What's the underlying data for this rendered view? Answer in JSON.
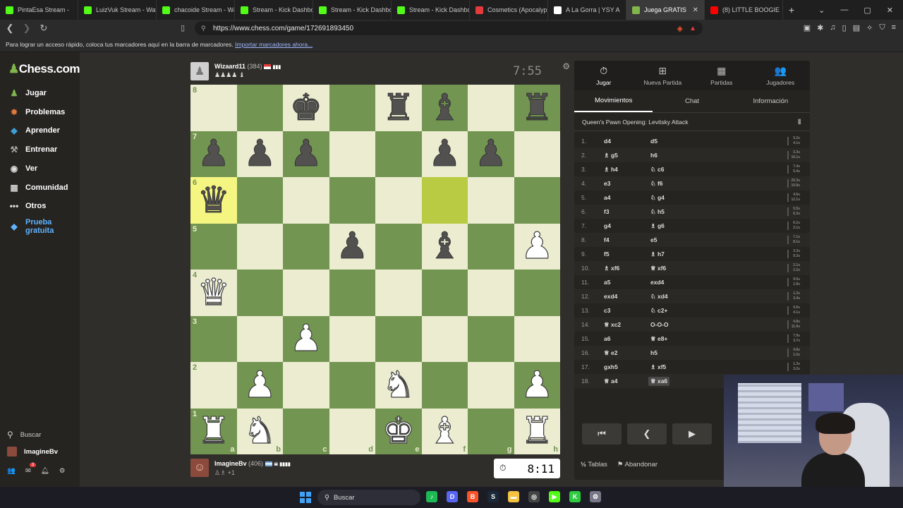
{
  "browser": {
    "tabs": [
      {
        "label": "PintaEsa Stream - ",
        "icon": "kick-icon",
        "color": "#53fc18",
        "active": false
      },
      {
        "label": "LuizVuk Stream - Wat",
        "icon": "kick-icon",
        "color": "#53fc18",
        "active": false
      },
      {
        "label": "chacoide Stream - Wa",
        "icon": "kick-icon",
        "color": "#53fc18",
        "active": false
      },
      {
        "label": "Stream - Kick Dashbo",
        "icon": "kick-icon",
        "color": "#53fc18",
        "active": false
      },
      {
        "label": "Stream - Kick Dashbo",
        "icon": "kick-icon",
        "color": "#53fc18",
        "active": false
      },
      {
        "label": "Stream - Kick Dashbo",
        "icon": "kick-icon",
        "color": "#53fc18",
        "active": false
      },
      {
        "label": "Cosmetics (Apocalyp",
        "icon": "a-icon",
        "color": "#e33b3b",
        "active": false
      },
      {
        "label": "A La Gorra | YSY A",
        "icon": "tiktok-icon",
        "color": "#ffffff",
        "active": false
      },
      {
        "label": "Juega GRATIS",
        "icon": "chess-icon",
        "color": "#81b64c",
        "active": true
      },
      {
        "label": "(8) LITTLE BOOGIE",
        "icon": "youtube-icon",
        "color": "#ff0000",
        "active": false
      }
    ],
    "url": "https://www.chess.com/game/172691893450",
    "bookmarks_text": "Para lograr un acceso rápido, coloca tus marcadores aquí en la barra de marcadores.",
    "bookmarks_link": "Importar marcadores ahora..."
  },
  "sidebar": {
    "logo": "Chess.com",
    "items": [
      {
        "label": "Jugar",
        "icon": "play-icon",
        "glyph": "♟",
        "color": "#81b64c"
      },
      {
        "label": "Problemas",
        "icon": "puzzle-icon",
        "glyph": "✸",
        "color": "#e27a3f"
      },
      {
        "label": "Aprender",
        "icon": "learn-icon",
        "glyph": "◆",
        "color": "#3aa0d8"
      },
      {
        "label": "Entrenar",
        "icon": "train-icon",
        "glyph": "⚒",
        "color": "#aaaaaa"
      },
      {
        "label": "Ver",
        "icon": "watch-icon",
        "glyph": "◉",
        "color": "#dddddd"
      },
      {
        "label": "Comunidad",
        "icon": "community-icon",
        "glyph": "▦",
        "color": "#cccccc"
      },
      {
        "label": "Otros",
        "icon": "more-icon",
        "glyph": "•••",
        "color": "#dddddd"
      }
    ],
    "trial_label_1": "Prueba",
    "trial_label_2": "gratuita",
    "search_label": "Buscar",
    "username": "ImagineBv",
    "notification_count": "3"
  },
  "game": {
    "opponent": {
      "name": "Wizaard11",
      "rating": "(384)",
      "captured": "♟♟♟♟ ♝",
      "clock": "7:55"
    },
    "me": {
      "name": "ImagineBv",
      "rating": "(406)",
      "captured": "♙♗ +1",
      "clock": "8:11"
    },
    "board": [
      [
        "",
        "",
        "bk",
        "",
        "br",
        "bb",
        "",
        "br"
      ],
      [
        "bp",
        "bp",
        "bp",
        "",
        "",
        "bp",
        "bp",
        ""
      ],
      [
        "bq",
        "",
        "",
        "",
        "",
        "",
        "",
        ""
      ],
      [
        "",
        "",
        "",
        "bp",
        "",
        "bb",
        "",
        "wp"
      ],
      [
        "wq",
        "",
        "",
        "",
        "",
        "",
        "",
        ""
      ],
      [
        "",
        "",
        "wp",
        "",
        "",
        "",
        "",
        ""
      ],
      [
        "",
        "wp",
        "",
        "",
        "wn",
        "",
        "",
        "wp"
      ],
      [
        "wr",
        "wn",
        "",
        "",
        "wk",
        "wb",
        "",
        "wr"
      ]
    ],
    "highlights": [
      [
        2,
        0
      ],
      [
        2,
        5
      ]
    ],
    "ranks": [
      "8",
      "7",
      "6",
      "5",
      "4",
      "3",
      "2",
      "1"
    ],
    "files": [
      "a",
      "b",
      "c",
      "d",
      "e",
      "f",
      "g",
      "h"
    ]
  },
  "panel": {
    "tabs": [
      {
        "label": "Jugar",
        "icon": "stopwatch-icon",
        "glyph": "⏱"
      },
      {
        "label": "Nueva Partida",
        "icon": "plus-icon",
        "glyph": "⊞"
      },
      {
        "label": "Partidas",
        "icon": "board-icon",
        "glyph": "▦"
      },
      {
        "label": "Jugadores",
        "icon": "players-icon",
        "glyph": "👥"
      }
    ],
    "subtabs": [
      "Movimientos",
      "Chat",
      "Información"
    ],
    "opening": "Queen's Pawn Opening: Levitsky Attack",
    "moves": [
      {
        "n": "1.",
        "w": "d4",
        "b": "d5",
        "tw": "5.2s",
        "tb": "4.1s"
      },
      {
        "n": "2.",
        "w": "♗ g5",
        "b": "h6",
        "tw": "3.3s",
        "tb": "16.1s"
      },
      {
        "n": "3.",
        "w": "♗ h4",
        "b": "♘ c6",
        "tw": "7.4s",
        "tb": "5.4s"
      },
      {
        "n": "4.",
        "w": "e3",
        "b": "♘ f6",
        "tw": "20.3s",
        "tb": "10.8s"
      },
      {
        "n": "5.",
        "w": "a4",
        "b": "♘ g4",
        "tw": "4.6s",
        "tb": "12.1s"
      },
      {
        "n": "6.",
        "w": "f3",
        "b": "♘ h5",
        "tw": "5.5s",
        "tb": "6.3s"
      },
      {
        "n": "7.",
        "w": "g4",
        "b": "♗ g6",
        "tw": "6.1s",
        "tb": "2.1s"
      },
      {
        "n": "8.",
        "w": "f4",
        "b": "e5",
        "tw": "7.1s",
        "tb": "8.1s"
      },
      {
        "n": "9.",
        "w": "f5",
        "b": "♗ h7",
        "tw": "3.3s",
        "tb": "9.3s"
      },
      {
        "n": "10.",
        "w": "♗ xf6",
        "b": "♕ xf6",
        "tw": "2.1s",
        "tb": "2.2s"
      },
      {
        "n": "11.",
        "w": "a5",
        "b": "exd4",
        "tw": "9.5s",
        "tb": "1.8s"
      },
      {
        "n": "12.",
        "w": "exd4",
        "b": "♘ xd4",
        "tw": "1.3s",
        "tb": "3.4s"
      },
      {
        "n": "13.",
        "w": "c3",
        "b": "♘ c2+",
        "tw": "0.6s",
        "tb": "4.1s"
      },
      {
        "n": "14.",
        "w": "♕ xc2",
        "b": "O-O-O",
        "tw": "4.8s",
        "tb": "11.9s"
      },
      {
        "n": "15.",
        "w": "a6",
        "b": "♕ e8+",
        "tw": "7.9s",
        "tb": "3.7s"
      },
      {
        "n": "16.",
        "w": "♕ e2",
        "b": "h5",
        "tw": "4.8s",
        "tb": "1.0s"
      },
      {
        "n": "17.",
        "w": "gxh5",
        "b": "♗ xf5",
        "tw": "1.3s",
        "tb": "3.2s"
      },
      {
        "n": "18.",
        "w": "♕ a4",
        "b": "♕ xa6",
        "tw": "1.3s",
        "tb": "1.4s"
      }
    ],
    "draw_label": "Tablas",
    "draw_prefix": "½",
    "resign_label": "Abandonar"
  },
  "taskbar": {
    "search_label": "Buscar",
    "apps": [
      {
        "icon": "spotify-icon",
        "color": "#1db954",
        "glyph": "♪"
      },
      {
        "icon": "discord-icon",
        "color": "#5865f2",
        "glyph": "D"
      },
      {
        "icon": "brave-icon",
        "color": "#fb542b",
        "glyph": "B"
      },
      {
        "icon": "steam-icon",
        "color": "#1b2838",
        "glyph": "S"
      },
      {
        "icon": "folder-icon",
        "color": "#f5c242",
        "glyph": "▬"
      },
      {
        "icon": "obs-icon",
        "color": "#444444",
        "glyph": "◎"
      },
      {
        "icon": "kick-icon",
        "color": "#53fc18",
        "glyph": "▶"
      },
      {
        "icon": "kick-studio-icon",
        "color": "#2ecc40",
        "glyph": "K"
      },
      {
        "icon": "settings-icon",
        "color": "#777788",
        "glyph": "⚙"
      }
    ]
  }
}
